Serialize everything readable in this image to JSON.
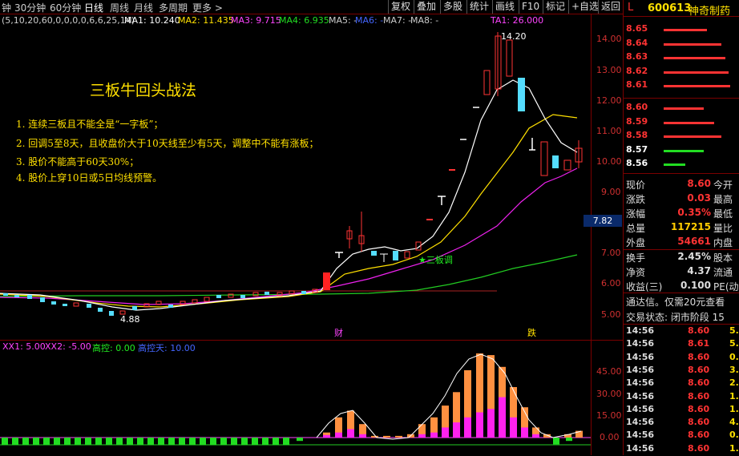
{
  "toolbar": {
    "periods": [
      "钟",
      "30分钟",
      "60分钟",
      "日线",
      "周线",
      "月线",
      "多周期",
      "更多 >"
    ],
    "buttons": [
      "复权",
      "叠加",
      "多股",
      "统计",
      "画线",
      "F10",
      "标记",
      "+自选",
      "返回"
    ]
  },
  "ma_line": {
    "params": "(5,10,20,60,0,0,0,0,6,6,25,14)",
    "ma1": "MA1: 10.240",
    "ma2": "MA2: 11.435",
    "ma3": "MA3: 9.715",
    "ma4": "MA4: 6.935",
    "ma5": "MA5: -",
    "ma6": "MA6: -",
    "ma7": "MA7: -",
    "ma8": "MA8: -",
    "ta1": "TA1: 26.000"
  },
  "main_chart": {
    "y_ticks": [
      "14.00",
      "13.00",
      "12.00",
      "11.00",
      "10.00",
      "9.00",
      "7.00",
      "6.00",
      "5.00"
    ],
    "current_price_tag": "7.82",
    "high_label": "14.20",
    "low_label": "4.88",
    "annotation_star": "★三板调",
    "marker_cai": "财",
    "marker_die": "跌"
  },
  "strategy": {
    "title": "三板牛回头战法",
    "rules": [
      "1. 连续三板且不能全是“一字板”；",
      "2. 回调5至8天，且收盘价大于10天线至少有5天，调整中不能有涨板；",
      "3. 股价不能高于60天30%；",
      "4. 股价上穿10日或5日均线预警。"
    ]
  },
  "sub_chart": {
    "xx1": "XX1: 5.00",
    "xx2": "XX2: -5.00",
    "gk": "高控: 0.00",
    "gkt": "高控天: 10.00",
    "y_ticks": [
      "45.00",
      "30.00",
      "15.00",
      "0.00"
    ]
  },
  "chart_data": {
    "type": "bar",
    "title": "",
    "series": [
      {
        "name": "",
        "values": [
          0,
          0,
          0,
          0,
          0,
          0,
          0,
          0,
          0,
          0,
          0,
          0,
          0,
          0,
          0,
          0,
          0,
          0,
          0,
          0,
          0,
          0,
          0,
          0,
          0,
          0,
          0,
          0,
          0,
          0,
          0,
          0,
          0,
          0,
          0,
          0,
          0,
          0,
          0,
          0,
          0,
          0,
          0,
          0,
          0,
          0,
          0,
          0,
          0,
          0,
          0,
          0,
          0,
          0,
          0,
          0,
          0,
          0,
          0,
          0,
          0,
          0,
          0,
          0,
          0,
          0,
          0,
          0,
          0,
          0,
          0,
          0,
          0,
          0,
          0,
          0,
          0,
          0,
          0,
          0,
          0,
          0,
          0,
          0,
          0,
          0,
          0,
          0,
          0,
          0,
          0,
          0,
          0,
          0,
          0,
          0,
          0,
          0,
          0,
          0,
          0,
          0,
          0,
          0,
          0,
          0,
          0,
          0,
          0,
          0,
          0,
          0,
          0,
          0,
          0,
          0,
          0,
          0,
          0,
          0,
          0,
          0,
          0,
          0,
          0,
          0,
          0,
          0,
          0,
          0,
          0,
          0,
          0,
          0,
          0,
          0,
          0,
          0,
          0,
          0
        ]
      }
    ],
    "ylim": [
      0,
      55
    ]
  },
  "quote": {
    "code": "600613",
    "name": "神奇制药",
    "flag": "L",
    "asks": [
      {
        "price": "8.65",
        "bar": 60
      },
      {
        "price": "8.64",
        "bar": 80
      },
      {
        "price": "8.63",
        "bar": 85
      },
      {
        "price": "8.62",
        "bar": 90
      },
      {
        "price": "8.61",
        "bar": 92
      }
    ],
    "bids": [
      {
        "price": "8.60",
        "bar": 55
      },
      {
        "price": "8.59",
        "bar": 70
      },
      {
        "price": "8.58",
        "bar": 80
      },
      {
        "price": "8.57",
        "bar": 55,
        "green": true
      },
      {
        "price": "8.56",
        "bar": 30,
        "green": true
      }
    ],
    "stats": [
      {
        "l": "现价",
        "v": "8.60",
        "r": "今开",
        "c": "#ff3333"
      },
      {
        "l": "涨跌",
        "v": "0.03",
        "r": "最高",
        "c": "#ff3333"
      },
      {
        "l": "涨幅",
        "v": "0.35%",
        "r": "最低",
        "c": "#ff3333"
      },
      {
        "l": "总量",
        "v": "117215",
        "r": "量比",
        "c": "#ffcc00"
      },
      {
        "l": "外盘",
        "v": "54661",
        "r": "内盘",
        "c": "#ff3333"
      }
    ],
    "stats2": [
      {
        "l": "换手",
        "v": "2.45%",
        "r": "股本",
        "c": "#ddd"
      },
      {
        "l": "净资",
        "v": "4.37",
        "r": "流通",
        "c": "#ddd"
      },
      {
        "l": "收益(三)",
        "v": "0.100",
        "r": "PE(动",
        "c": "#ddd"
      }
    ],
    "notice": "通达信。仅需20元查看",
    "status": "交易状态: 闭市阶段 15",
    "ticks": [
      {
        "t": "14:56",
        "p": "8.60",
        "v": "5."
      },
      {
        "t": "14:56",
        "p": "8.61",
        "v": "5."
      },
      {
        "t": "14:56",
        "p": "8.60",
        "v": "0."
      },
      {
        "t": "14:56",
        "p": "8.60",
        "v": "3."
      },
      {
        "t": "14:56",
        "p": "8.60",
        "v": "2."
      },
      {
        "t": "14:56",
        "p": "8.60",
        "v": "1."
      },
      {
        "t": "14:56",
        "p": "8.60",
        "v": "1."
      },
      {
        "t": "14:56",
        "p": "8.60",
        "v": "4."
      },
      {
        "t": "14:56",
        "p": "8.60",
        "v": "0."
      },
      {
        "t": "14:56",
        "p": "8.60",
        "v": "1."
      }
    ]
  }
}
